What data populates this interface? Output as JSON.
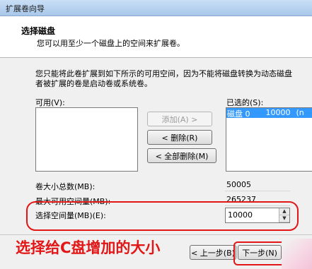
{
  "window": {
    "title": "扩展卷向导"
  },
  "header": {
    "title": "选择磁盘",
    "subtitle": "您可以用至少一个磁盘上的空间来扩展卷。"
  },
  "description": {
    "line1": "您只能将此卷扩展到如下所示的可用空间，因为不能将磁盘转换为动态磁盘",
    "line2": "者被扩展的卷是启动卷或系统卷。"
  },
  "available": {
    "label": "可用(V):"
  },
  "selected": {
    "label": "已选的(S):",
    "items": [
      {
        "disk": "磁盘 0",
        "size": "10000",
        "extra": "(n"
      }
    ]
  },
  "buttons": {
    "add": "添加(A) >",
    "remove": "< 删除(R)",
    "remove_all": "< 全部删除(M)",
    "back": "< 上一步(B)",
    "next": "下一步(N)"
  },
  "fields": {
    "total_label": "卷大小总数(MB):",
    "total_value": "50005",
    "max_label": "最大可用空间量(MB):",
    "max_value": "265237",
    "select_label": "选择空间量(MB)(E):",
    "select_value": "10000"
  },
  "annotation": {
    "text": "选择给C盘增加的大小",
    "color": "#e21616"
  }
}
